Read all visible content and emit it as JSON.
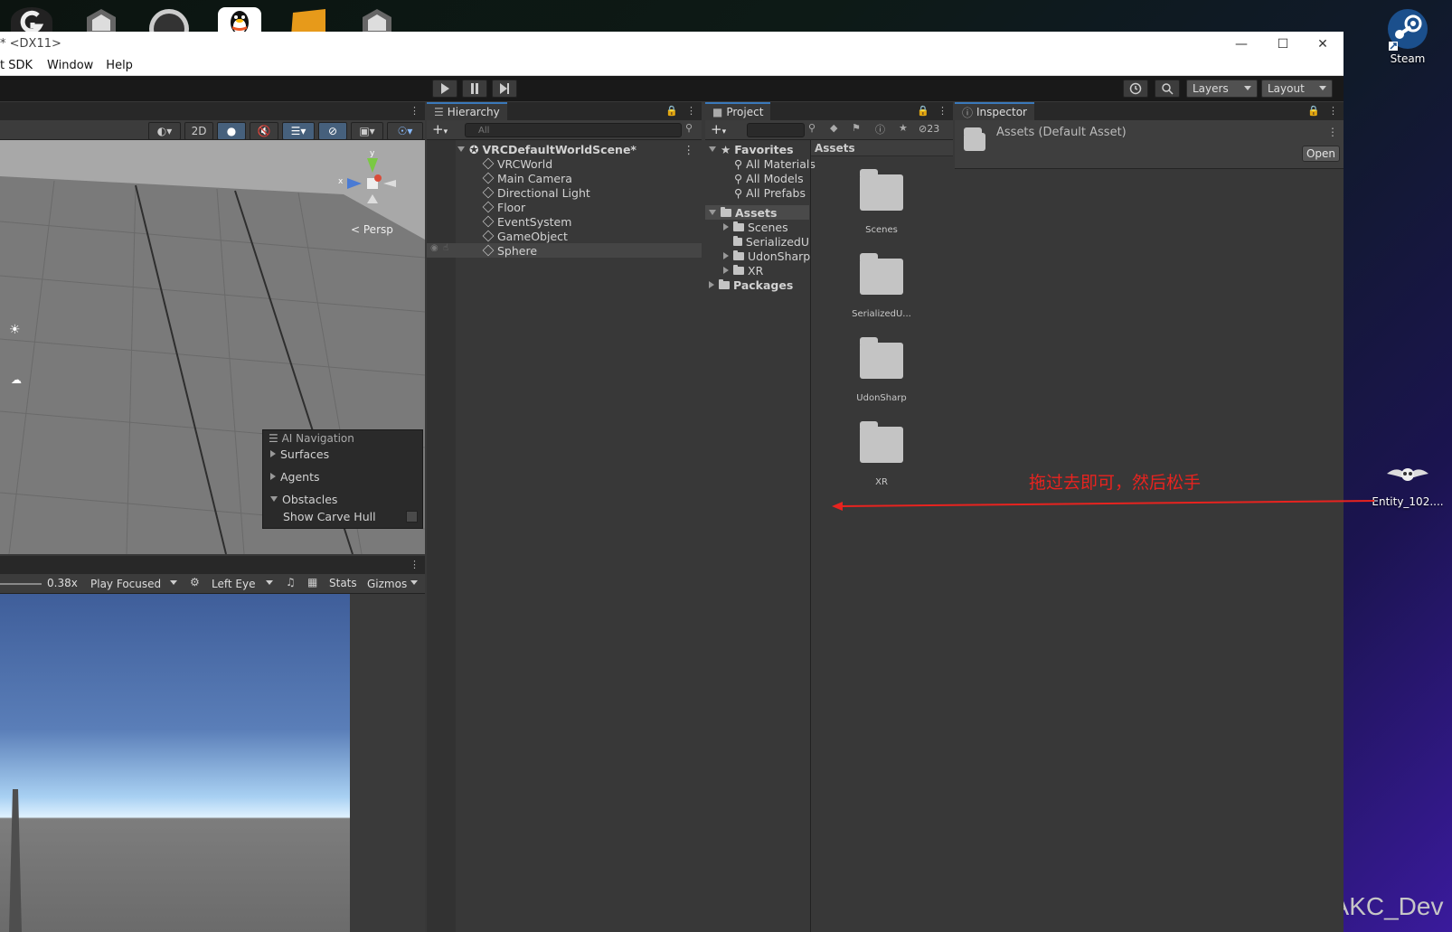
{
  "window": {
    "title": "* <DX11>",
    "menu": [
      "t SDK",
      "Window",
      "Help"
    ]
  },
  "toolbar": {
    "layers_label": "Layers",
    "layout_label": "Layout"
  },
  "scene": {
    "btn_2d": "2D",
    "persp_label": "Persp",
    "gizmo_x": "x",
    "gizmo_y": "y",
    "ai_nav": {
      "title": "AI Navigation",
      "items": [
        "Surfaces",
        "Agents",
        "Obstacles"
      ],
      "show_carve_hull": "Show Carve Hull"
    }
  },
  "game": {
    "scale": "0.38x",
    "play_mode": "Play Focused",
    "eye": "Left Eye",
    "stats": "Stats",
    "gizmos": "Gizmos"
  },
  "hierarchy": {
    "tab": "Hierarchy",
    "search_placeholder": "All",
    "scene_name": "VRCDefaultWorldScene*",
    "items": [
      "VRCWorld",
      "Main Camera",
      "Directional Light",
      "Floor",
      "EventSystem",
      "GameObject",
      "Sphere"
    ]
  },
  "project": {
    "tab": "Project",
    "hidden_count": "23",
    "favorites_label": "Favorites",
    "favorites": [
      "All Materials",
      "All Models",
      "All Prefabs"
    ],
    "assets_label": "Assets",
    "asset_folders": [
      "Scenes",
      "SerializedU",
      "UdonSharp",
      "XR"
    ],
    "packages_label": "Packages",
    "breadcrumb": "Assets",
    "grid_items": [
      "Scenes",
      "SerializedU...",
      "UdonSharp",
      "XR"
    ]
  },
  "inspector": {
    "tab": "Inspector",
    "title": "Assets (Default Asset)",
    "open_button": "Open"
  },
  "annotation": {
    "text": "拖过去即可，然后松手",
    "color": "#e8231f"
  },
  "desktop": {
    "steam": "Steam",
    "entity": "Entity_102....",
    "watermark": "CSDN @AKC_Dev"
  }
}
